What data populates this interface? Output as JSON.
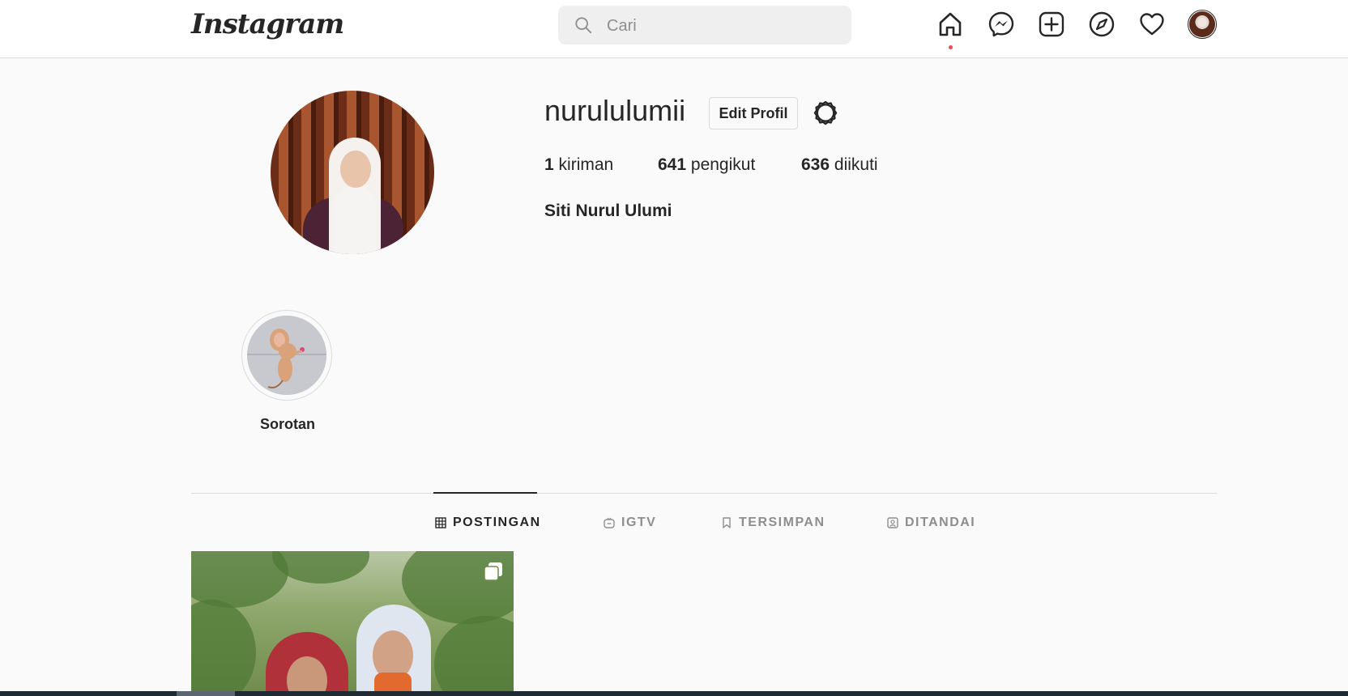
{
  "header": {
    "logo": "Instagram",
    "search_placeholder": "Cari",
    "icons": [
      "home-icon",
      "messenger-icon",
      "new-post-icon",
      "explore-icon",
      "activity-heart-icon",
      "profile-avatar"
    ]
  },
  "profile": {
    "username": "nurululumii",
    "edit_label": "Edit Profil",
    "stats": {
      "posts_count": "1",
      "posts_label": "kiriman",
      "followers_count": "641",
      "followers_label": "pengikut",
      "following_count": "636",
      "following_label": "diikuti"
    },
    "full_name": "Siti Nurul Ulumi"
  },
  "highlights": [
    {
      "label": "Sorotan"
    }
  ],
  "tabs": [
    {
      "label": "POSTINGAN",
      "icon": "grid-icon",
      "active": true
    },
    {
      "label": "IGTV",
      "icon": "igtv-icon",
      "active": false
    },
    {
      "label": "TERSIMPAN",
      "icon": "bookmark-icon",
      "active": false
    },
    {
      "label": "DITANDAI",
      "icon": "tagged-icon",
      "active": false
    }
  ],
  "colors": {
    "background": "#fafafa",
    "text": "#262626",
    "muted": "#8e8e8e",
    "border": "#dbdbdb",
    "notification_dot": "#ed4956"
  }
}
